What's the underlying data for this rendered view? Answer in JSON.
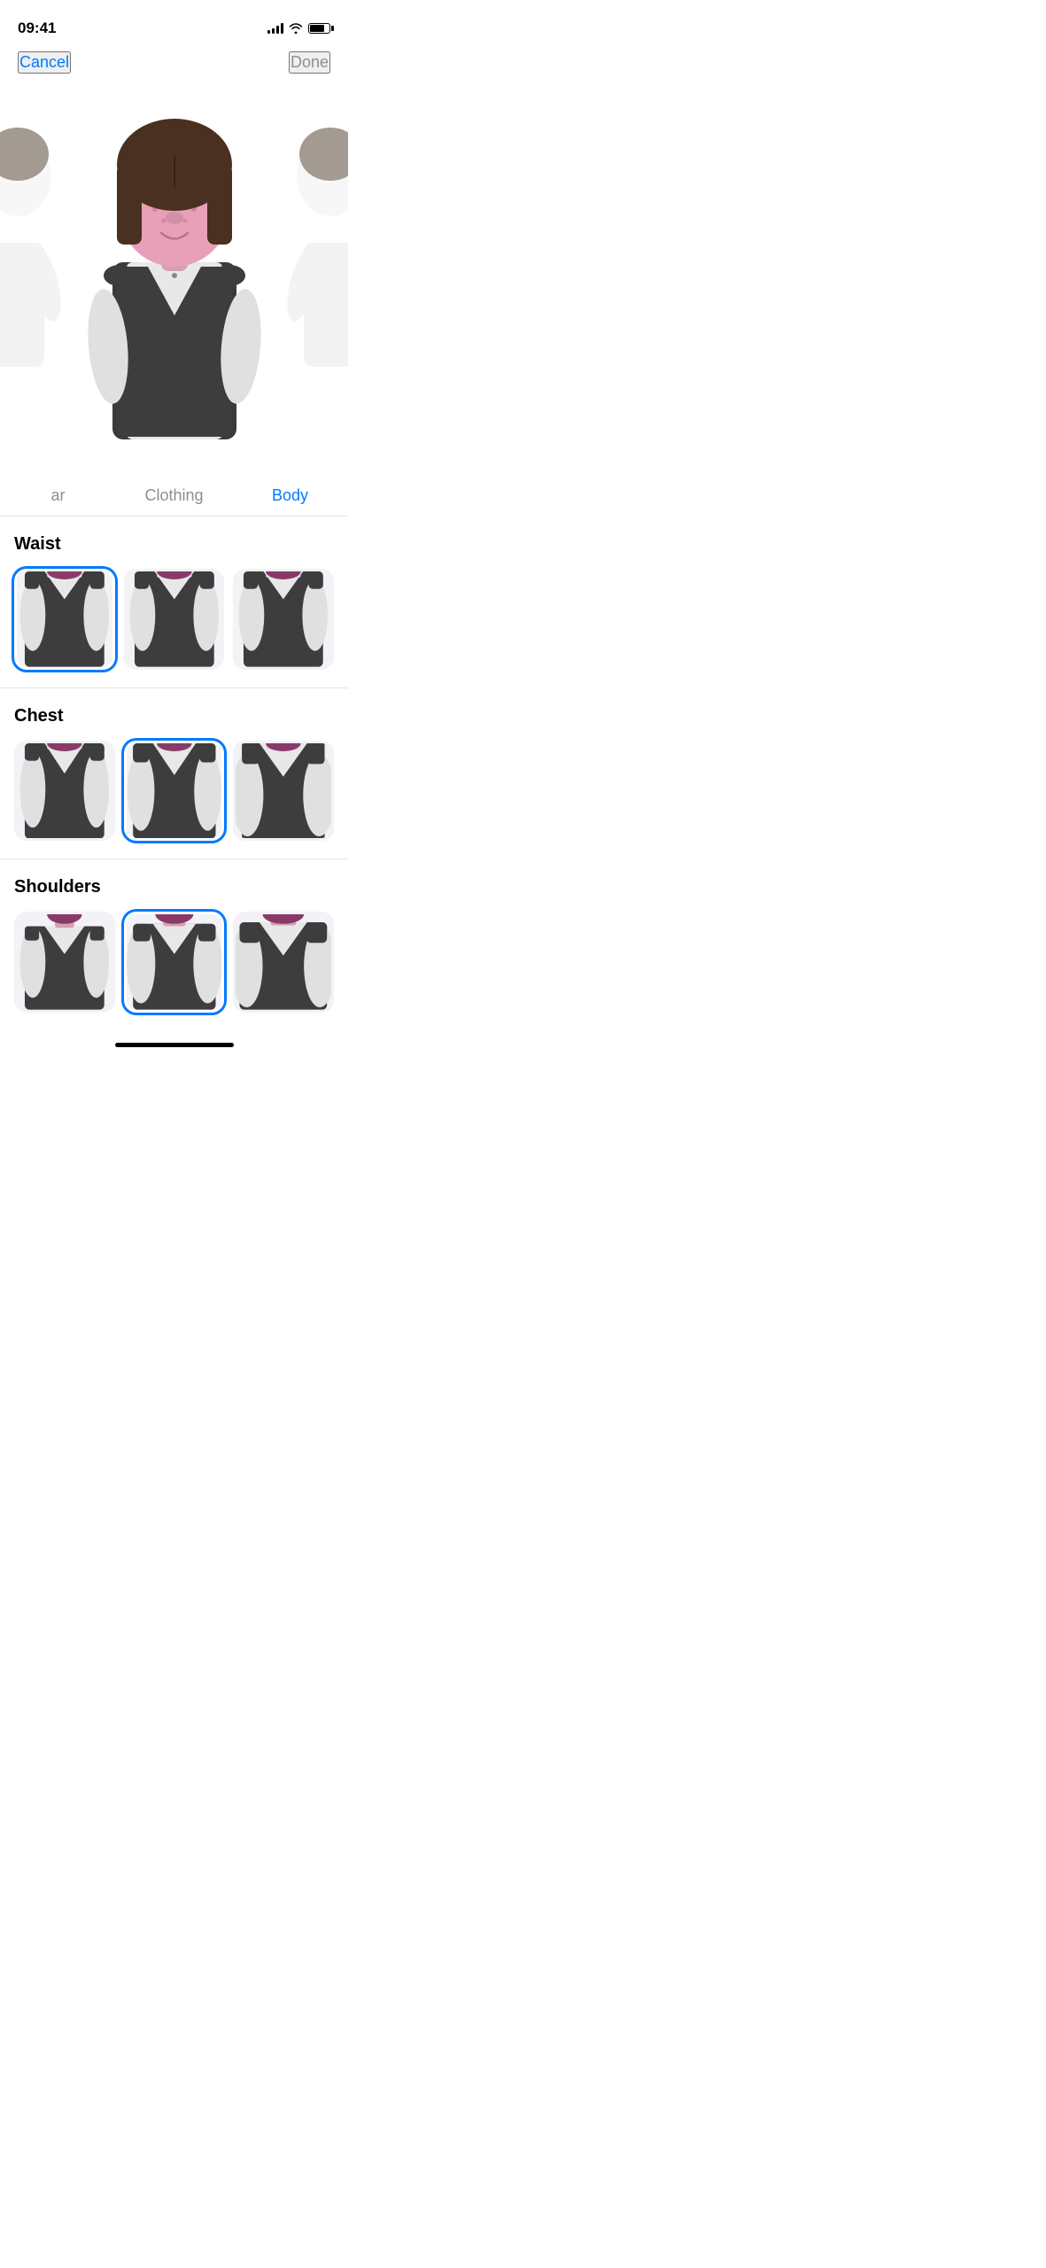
{
  "statusBar": {
    "time": "09:41",
    "signalBars": 4,
    "hasBattery": true
  },
  "navBar": {
    "cancelLabel": "Cancel",
    "doneLabel": "Done"
  },
  "segments": [
    {
      "id": "headwear",
      "label": "ar",
      "active": false
    },
    {
      "id": "clothing",
      "label": "Clothing",
      "active": false
    },
    {
      "id": "body",
      "label": "Body",
      "active": true
    }
  ],
  "sections": [
    {
      "id": "waist",
      "title": "Waist",
      "selectedIndex": 0,
      "options": [
        {
          "id": "waist-1",
          "selected": true
        },
        {
          "id": "waist-2",
          "selected": false
        },
        {
          "id": "waist-3",
          "selected": false
        }
      ]
    },
    {
      "id": "chest",
      "title": "Chest",
      "selectedIndex": 1,
      "options": [
        {
          "id": "chest-1",
          "selected": false
        },
        {
          "id": "chest-2",
          "selected": true
        },
        {
          "id": "chest-3",
          "selected": false
        }
      ]
    },
    {
      "id": "shoulders",
      "title": "Shoulders",
      "selectedIndex": 1,
      "options": [
        {
          "id": "shoulders-1",
          "selected": false
        },
        {
          "id": "shoulders-2",
          "selected": true
        },
        {
          "id": "shoulders-3",
          "selected": false
        }
      ]
    }
  ]
}
